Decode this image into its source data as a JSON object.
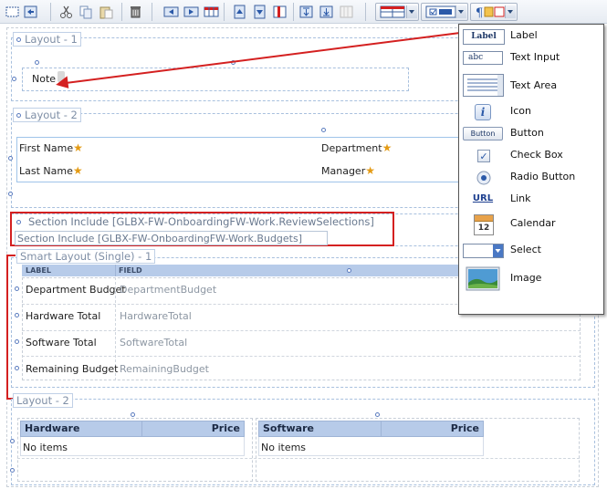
{
  "toolbar": {
    "buttons": [
      "select-all",
      "refresh",
      "cut",
      "copy",
      "paste",
      "delete",
      "move-left",
      "move-right",
      "insert-table",
      "move-up",
      "move-down",
      "columns",
      "insert-top",
      "insert-bottom",
      "disabled-columns"
    ],
    "dropdowns": [
      "layout-dropdown",
      "control-dropdown",
      "formatting-dropdown"
    ]
  },
  "canvas": {
    "layout1": {
      "caption": "Layout - 1",
      "note": "Note"
    },
    "layout2": {
      "caption": "Layout - 2",
      "first_name": "First Name",
      "last_name": "Last Name",
      "department": "Department",
      "manager": "Manager",
      "required_mark": "★"
    },
    "section_include_1": "Section Include [GLBX-FW-OnboardingFW-Work.ReviewSelections]",
    "section_include_2": "Section Include [GLBX-FW-OnboardingFW-Work.Budgets]",
    "smart_layout": {
      "caption": "Smart Layout (Single) - 1",
      "header_label": "LABEL",
      "header_field": "FIELD",
      "rows": [
        {
          "label": "Department Budget",
          "field": "DepartmentBudget"
        },
        {
          "label": "Hardware Total",
          "field": "HardwareTotal"
        },
        {
          "label": "Software Total",
          "field": "SoftwareTotal"
        },
        {
          "label": "Remaining Budget",
          "field": "RemainingBudget"
        }
      ]
    },
    "layout2_bottom": {
      "caption": "Layout - 2",
      "hardware_table": {
        "col1": "Hardware",
        "col2": "Price",
        "empty": "No items"
      },
      "software_table": {
        "col1": "Software",
        "col2": "Price",
        "empty": "No items"
      }
    }
  },
  "palette": {
    "items": [
      {
        "label": "Label",
        "icon": "label-icon",
        "icon_text": "Label"
      },
      {
        "label": "Text Input",
        "icon": "text-input-icon",
        "icon_text": "abc"
      },
      {
        "label": "Text Area",
        "icon": "text-area-icon"
      },
      {
        "label": "Icon",
        "icon": "info-icon",
        "icon_text": "i"
      },
      {
        "label": "Button",
        "icon": "button-icon",
        "icon_text": "Button"
      },
      {
        "label": "Check Box",
        "icon": "checkbox-icon",
        "icon_text": "✓"
      },
      {
        "label": "Radio Button",
        "icon": "radio-icon"
      },
      {
        "label": "Link",
        "icon": "link-icon",
        "icon_text": "URL"
      },
      {
        "label": "Calendar",
        "icon": "calendar-icon",
        "icon_text": "12"
      },
      {
        "label": "Select",
        "icon": "select-icon"
      },
      {
        "label": "Image",
        "icon": "image-icon"
      }
    ]
  },
  "colors": {
    "accent": "#5b7cbf",
    "callout": "#d42020",
    "header_fill": "#b7cbe9",
    "required": "#e49b15"
  }
}
